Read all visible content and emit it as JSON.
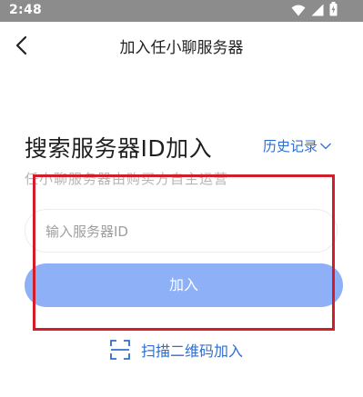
{
  "status_bar": {
    "time": "2:48",
    "icons": [
      "wifi-icon",
      "signal-icon",
      "battery-icon"
    ]
  },
  "nav": {
    "back_icon": "chevron-left-icon",
    "title": "加入任小聊服务器"
  },
  "search": {
    "heading": "搜索服务器ID加入",
    "history_label": "历史记录",
    "history_icon": "chevron-down-icon",
    "subtitle": "任小聊服务器由购买方自主运营",
    "input_placeholder": "输入服务器ID",
    "input_value": "",
    "join_label": "加入"
  },
  "scan": {
    "icon": "scan-icon",
    "label": "扫描二维码加入"
  },
  "colors": {
    "status_bar": "#8c8c8c",
    "accent": "#2f6ecf",
    "join_button": "#8db0f7",
    "highlight": "#d01f2a"
  }
}
